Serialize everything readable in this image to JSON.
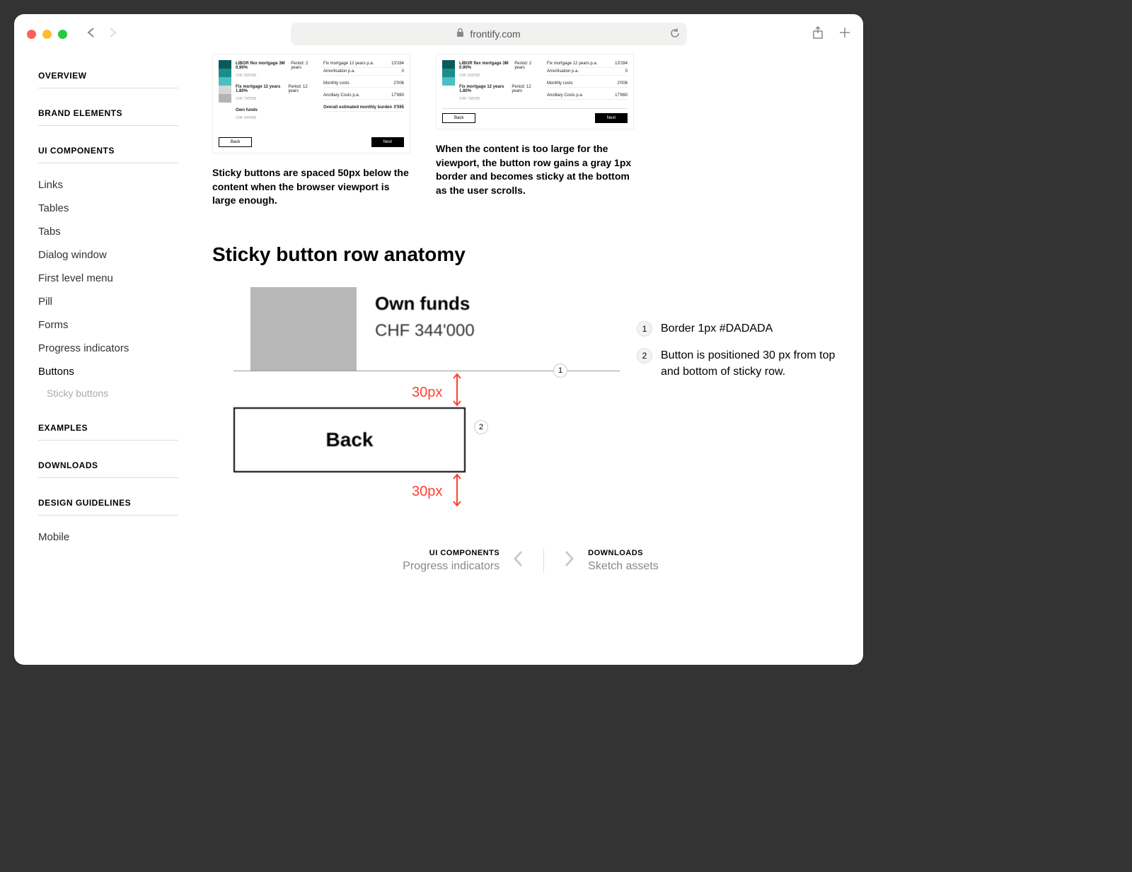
{
  "browser": {
    "url": "frontify.com"
  },
  "sidebar": {
    "sections": [
      {
        "title": "OVERVIEW",
        "items": []
      },
      {
        "title": "BRAND ELEMENTS",
        "items": []
      },
      {
        "title": "UI COMPONENTS",
        "items": [
          "Links",
          "Tables",
          "Tabs",
          "Dialog window",
          "First level menu",
          "Pill",
          "Forms",
          "Progress indicators",
          "Buttons"
        ],
        "subitem": "Sticky buttons"
      },
      {
        "title": "EXAMPLES",
        "items": []
      },
      {
        "title": "DOWNLOADS",
        "items": []
      },
      {
        "title": "DESIGN GUIDELINES",
        "items": [
          "Mobile"
        ]
      }
    ]
  },
  "examples": {
    "swatches": [
      "#0a5a5a",
      "#1b8c8c",
      "#4bbfbf",
      "#d6d6d6",
      "#b4b4b4"
    ],
    "row1": {
      "l": "LIBOR flex mortgage 3M 0.90%",
      "m": "Period: 2 years",
      "sub": "CHF 328'000"
    },
    "row2": {
      "l": "Fix mortgage 12 years 1.80%",
      "m": "Period: 12 years",
      "sub": "CHF 738'000"
    },
    "own": {
      "l": "Own funds",
      "sub": "CHF 344'000"
    },
    "right_lines": [
      {
        "l": "Fix mortgage 12 years p.a.",
        "r": "13'284"
      },
      {
        "l": "Amortisation p.a.",
        "r": "0"
      },
      {
        "l": "Monthly costs",
        "r": "2'006"
      },
      {
        "l": "Ancillary Costs p.a.",
        "r": "17'860"
      },
      {
        "l": "Overall estimated monthly burden",
        "r": "3'595"
      }
    ],
    "back": "Back",
    "next": "Next",
    "caption1": "Sticky buttons are spaced 50px below the content when the browser viewport is large enough.",
    "caption2": "When the content is too large for the viewport, the button row gains a gray 1px border and becomes sticky at the bottom as the user scrolls."
  },
  "anatomy": {
    "title": "Sticky button row anatomy",
    "own_label": "Own funds",
    "own_value": "CHF 344'000",
    "back": "Back",
    "dim": "30px",
    "legend": [
      "Border 1px #DADADA",
      "Button is positioned 30 px from top and bottom of sticky row."
    ]
  },
  "pager": {
    "prev_cat": "UI COMPONENTS",
    "prev_name": "Progress indicators",
    "next_cat": "DOWNLOADS",
    "next_name": "Sketch assets"
  }
}
